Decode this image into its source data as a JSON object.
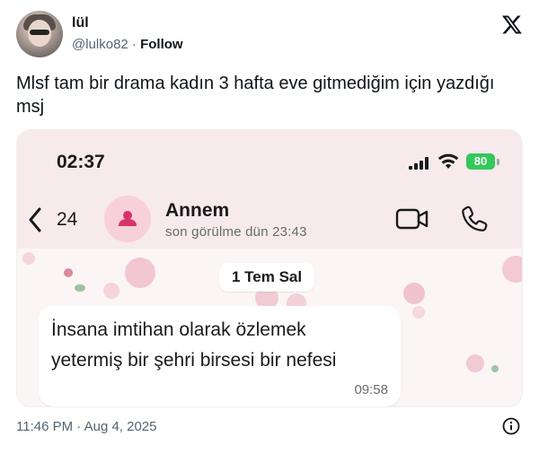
{
  "author": {
    "display_name": "lül",
    "handle": "@lulko82",
    "separator": "·",
    "follow_label": "Follow"
  },
  "icons": {
    "brand": "x-logo-icon",
    "info": "info-icon",
    "back": "chevron-left-icon",
    "video": "video-camera-icon",
    "call": "phone-icon",
    "contact": "person-icon"
  },
  "tweet": {
    "text_lines": [
      "Mlsf tam bir drama kadın 3 hafta eve gitmediğim için yazdığı",
      "msj"
    ],
    "timestamp": "11:46 PM · Aug 4, 2025"
  },
  "screenshot": {
    "status_bar": {
      "time": "02:37",
      "battery": "80"
    },
    "chat_header": {
      "unread_count": "24",
      "contact_name": "Annem",
      "last_seen": "son görülme dün 23:43"
    },
    "date_separator": "1 Tem Sal",
    "message": {
      "lines": [
        "İnsana imtihan olarak özlemek",
        "yetermiş bir şehri birsesi bir nefesi"
      ],
      "time": "09:58"
    }
  },
  "colors": {
    "battery": "#34c759",
    "contact_avatar_bg": "#f8d0da",
    "contact_icon": "#d6336c",
    "header_bg": "#f6eaed",
    "chat_bg": "#fbf5f5"
  }
}
